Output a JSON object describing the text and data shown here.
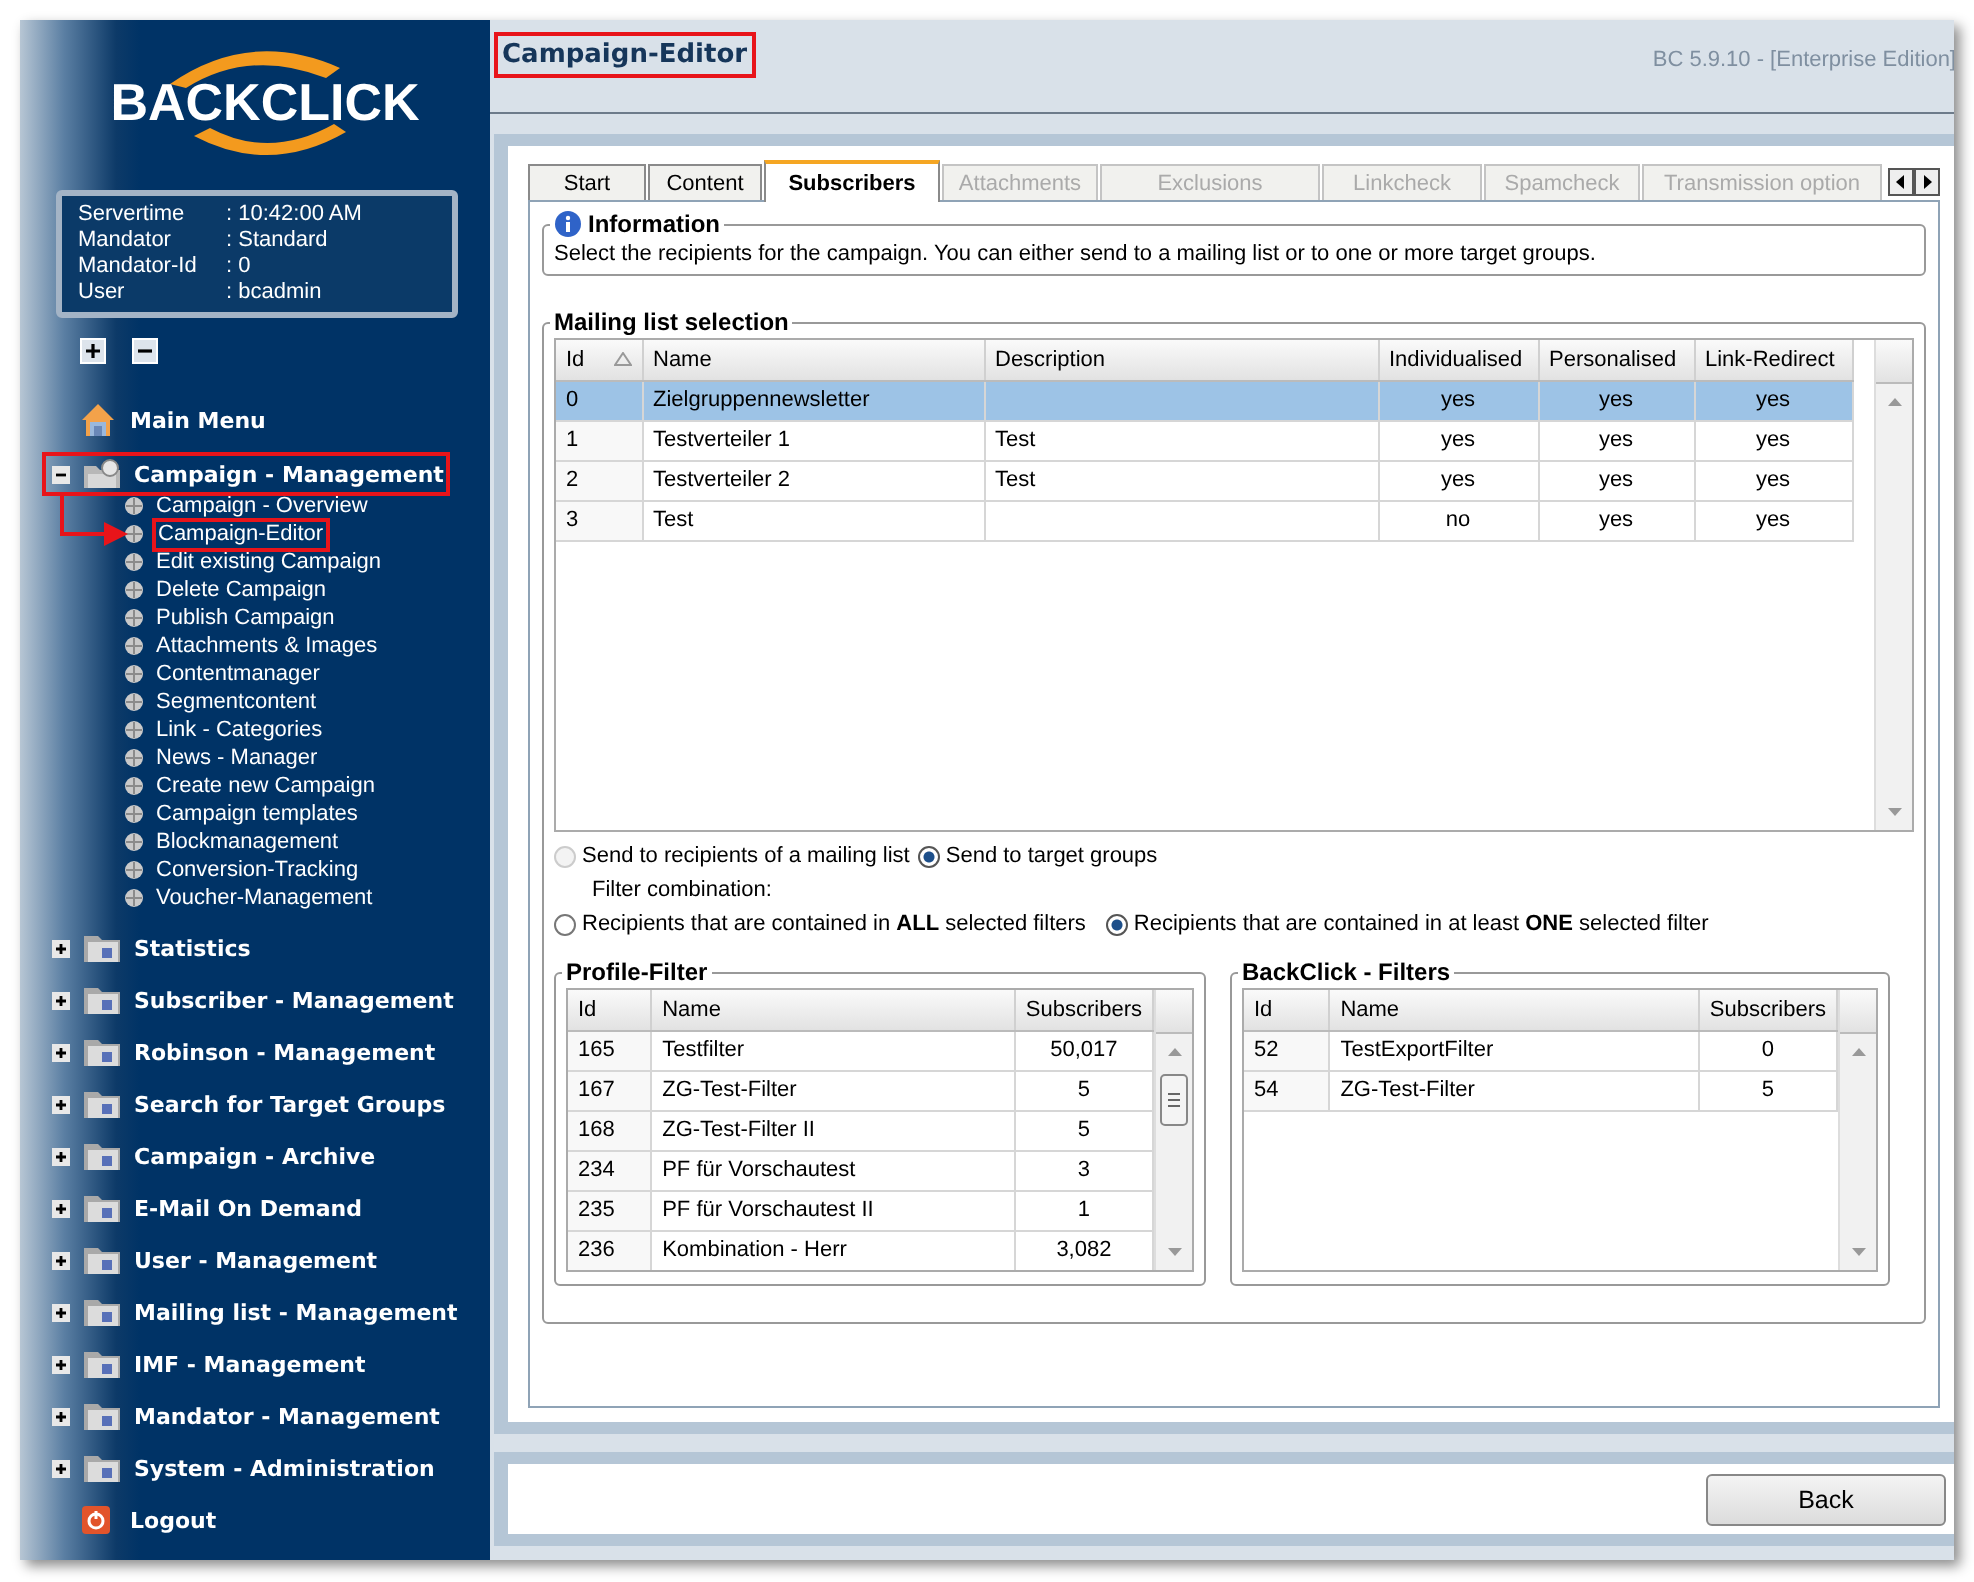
{
  "sidebar": {
    "logo": "BACKCLICK",
    "info": [
      {
        "label": "Servertime",
        "value": ": 10:42:00 AM"
      },
      {
        "label": "Mandator",
        "value": ": Standard"
      },
      {
        "label": "Mandator-Id",
        "value": ": 0"
      },
      {
        "label": "User",
        "value": ": bcadmin"
      }
    ],
    "nav": [
      {
        "kind": "home",
        "label": "Main Menu"
      },
      {
        "kind": "group",
        "label": "Campaign - Management",
        "expanded": true,
        "highlighted": true,
        "children": [
          {
            "label": "Campaign - Overview",
            "highlighted": false
          },
          {
            "label": "Campaign-Editor",
            "highlighted": true
          },
          {
            "label": "Edit existing Campaign",
            "highlighted": false
          },
          {
            "label": "Delete Campaign",
            "highlighted": false
          },
          {
            "label": "Publish Campaign",
            "highlighted": false
          },
          {
            "label": "Attachments & Images",
            "highlighted": false
          },
          {
            "label": "Contentmanager",
            "highlighted": false
          },
          {
            "label": "Segmentcontent",
            "highlighted": false
          },
          {
            "label": "Link - Categories",
            "highlighted": false
          },
          {
            "label": "News - Manager",
            "highlighted": false
          },
          {
            "label": "Create new Campaign",
            "highlighted": false
          },
          {
            "label": "Campaign templates",
            "highlighted": false
          },
          {
            "label": "Blockmanagement",
            "highlighted": false
          },
          {
            "label": "Conversion-Tracking",
            "highlighted": false
          },
          {
            "label": "Voucher-Management",
            "highlighted": false
          }
        ]
      },
      {
        "kind": "group",
        "label": "Statistics",
        "expanded": false,
        "highlighted": false
      },
      {
        "kind": "group",
        "label": "Subscriber - Management",
        "expanded": false,
        "highlighted": false
      },
      {
        "kind": "group",
        "label": "Robinson - Management",
        "expanded": false,
        "highlighted": false
      },
      {
        "kind": "group",
        "label": "Search for Target Groups",
        "expanded": false,
        "highlighted": false
      },
      {
        "kind": "group",
        "label": "Campaign - Archive",
        "expanded": false,
        "highlighted": false
      },
      {
        "kind": "group",
        "label": "E-Mail On Demand",
        "expanded": false,
        "highlighted": false
      },
      {
        "kind": "group",
        "label": "User - Management",
        "expanded": false,
        "highlighted": false
      },
      {
        "kind": "group",
        "label": "Mailing list - Management",
        "expanded": false,
        "highlighted": false
      },
      {
        "kind": "group",
        "label": "IMF - Management",
        "expanded": false,
        "highlighted": false
      },
      {
        "kind": "group",
        "label": "Mandator - Management",
        "expanded": false,
        "highlighted": false
      },
      {
        "kind": "group",
        "label": "System - Administration",
        "expanded": false,
        "highlighted": false
      },
      {
        "kind": "logout",
        "label": "Logout"
      }
    ]
  },
  "header": {
    "title": "Campaign-Editor",
    "title_highlighted": true,
    "version": "BC 5.9.10 - [Enterprise Edition]"
  },
  "tabs": [
    {
      "label": "Start",
      "selected": false,
      "disabled": false
    },
    {
      "label": "Content",
      "selected": false,
      "disabled": false
    },
    {
      "label": "Subscribers",
      "selected": true,
      "disabled": false
    },
    {
      "label": "Attachments",
      "selected": false,
      "disabled": true
    },
    {
      "label": "Exclusions",
      "selected": false,
      "disabled": true
    },
    {
      "label": "Linkcheck",
      "selected": false,
      "disabled": true
    },
    {
      "label": "Spamcheck",
      "selected": false,
      "disabled": true
    },
    {
      "label": "Transmission option",
      "selected": false,
      "disabled": true
    }
  ],
  "information": {
    "title": "Information",
    "text": "Select the recipients for the campaign. You can either send to a mailing list or to one or more target groups."
  },
  "mailing_list": {
    "title": "Mailing list selection",
    "columns": [
      "Id",
      "Name",
      "Description",
      "Individualised",
      "Personalised",
      "Link-Redirect"
    ],
    "rows": [
      {
        "cells": [
          "0",
          "Zielgruppennewsletter",
          "",
          "yes",
          "yes",
          "yes"
        ],
        "selected": true
      },
      {
        "cells": [
          "1",
          "Testverteiler 1",
          "Test",
          "yes",
          "yes",
          "yes"
        ],
        "selected": false
      },
      {
        "cells": [
          "2",
          "Testverteiler 2",
          "Test",
          "yes",
          "yes",
          "yes"
        ],
        "selected": false
      },
      {
        "cells": [
          "3",
          "Test",
          "",
          "no",
          "yes",
          "yes"
        ],
        "selected": false
      }
    ]
  },
  "send_mode": [
    {
      "label": "Send to recipients of a mailing list",
      "selected": false,
      "disabled": true
    },
    {
      "label": "Send to target groups",
      "selected": true,
      "disabled": false
    }
  ],
  "filter_combination": {
    "label": "Filter combination:",
    "options": [
      {
        "label": "Recipients that are contained in **ALL** selected filters",
        "selected": false
      },
      {
        "label": "Recipients that are contained in at least **ONE** selected filter",
        "selected": true
      }
    ]
  },
  "profile_filter": {
    "title": "Profile-Filter",
    "columns": [
      "Id",
      "Name",
      "Subscribers"
    ],
    "rows": [
      [
        "165",
        "Testfilter",
        "50,017"
      ],
      [
        "167",
        "ZG-Test-Filter",
        "5"
      ],
      [
        "168",
        "ZG-Test-Filter II",
        "5"
      ],
      [
        "234",
        "PF für Vorschautest",
        "3"
      ],
      [
        "235",
        "PF für Vorschautest II",
        "1"
      ],
      [
        "236",
        "Kombination - Herr",
        "3,082"
      ]
    ]
  },
  "backclick_filters": {
    "title": "BackClick - Filters",
    "columns": [
      "Id",
      "Name",
      "Subscribers"
    ],
    "rows": [
      [
        "52",
        "TestExportFilter",
        "0"
      ],
      [
        "54",
        "ZG-Test-Filter",
        "5"
      ]
    ]
  },
  "footer": {
    "button": "Back"
  }
}
